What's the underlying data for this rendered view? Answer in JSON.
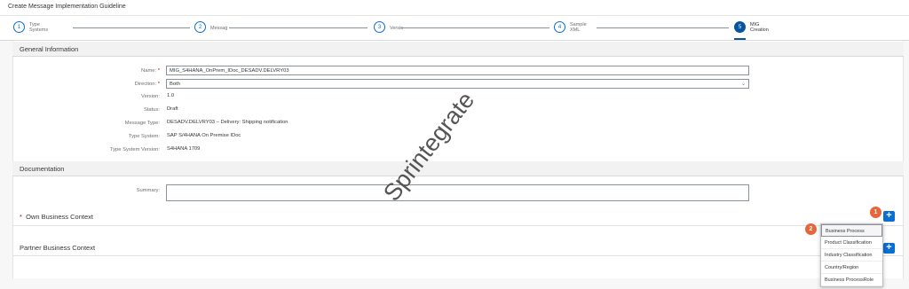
{
  "window": {
    "title": "Create Message Implementation Guideline"
  },
  "wizard": {
    "steps": [
      {
        "number": "1",
        "label_line1": "Type",
        "label_line2": "Systems"
      },
      {
        "number": "2",
        "label_line1": "Messag",
        "label_line2": ""
      },
      {
        "number": "3",
        "label_line1": "Versic",
        "label_line2": ""
      },
      {
        "number": "4",
        "label_line1": "Sample",
        "label_line2": "XML"
      },
      {
        "number": "5",
        "label_line1": "MIG",
        "label_line2": "Creation"
      }
    ],
    "active_step": 5
  },
  "general": {
    "title": "General Information",
    "name_label": "Name:",
    "name_value": "MIG_S4HANA_OnPrem_IDoc_DESADV.DELVRY03",
    "direction_label": "Direction:",
    "direction_value": "Both",
    "version_label": "Version:",
    "version_value": "1.0",
    "status_label": "Status:",
    "status_value": "Draft",
    "message_type_label": "Message Type:",
    "message_type_value": "DESADV.DELVRY03 – Delivery: Shipping notification",
    "type_system_label": "Type System:",
    "type_system_value": "SAP S/4HANA On Premise IDoc",
    "type_system_version_label": "Type System Version:",
    "type_system_version_value": "S4HANA 1709",
    "required_mark": "*"
  },
  "documentation": {
    "title": "Documentation",
    "summary_label": "Summary:"
  },
  "own_context": {
    "required_mark": "*",
    "title": "Own Business Context",
    "add_label": "+"
  },
  "partner_context": {
    "title": "Partner Business Context",
    "add_label": "+"
  },
  "watermark": "Sprintegrate",
  "callouts": {
    "one": "1",
    "two": "2"
  },
  "context_menu": {
    "items": [
      "Business Process",
      "Product Classification",
      "Industry Classification",
      "Country/Region",
      "Business ProcessRole"
    ]
  },
  "colors": {
    "accent": "#0a6ed1",
    "active_step": "#0854a0",
    "required": "#bb0000",
    "callout": "#e9643b"
  }
}
